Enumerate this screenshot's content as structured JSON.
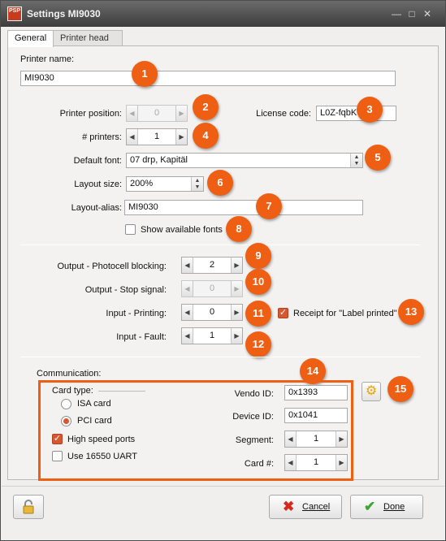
{
  "window": {
    "title": "Settings MI9030",
    "app_icon_text": "PSP"
  },
  "tabs": [
    {
      "label": "General",
      "active": true
    },
    {
      "label": "Printer head",
      "active": false
    }
  ],
  "general": {
    "printer_name_label": "Printer name:",
    "printer_name_value": "MI9030",
    "printer_position_label": "Printer position:",
    "printer_position_value": "0",
    "license_code_label": "License code:",
    "license_code_value": "L0Z-fqbK",
    "num_printers_label": "# printers:",
    "num_printers_value": "1",
    "default_font_label": "Default font:",
    "default_font_value": "07 drp, Kapitäl",
    "layout_size_label": "Layout size:",
    "layout_size_value": "200%",
    "layout_alias_label": "Layout-alias:",
    "layout_alias_value": "MI9030",
    "show_fonts_label": "Show available fonts",
    "show_fonts_checked": false
  },
  "io": {
    "photocell_label": "Output - Photocell blocking:",
    "photocell_value": "2",
    "stop_signal_label": "Output - Stop signal:",
    "stop_signal_value": "0",
    "printing_label": "Input - Printing:",
    "printing_value": "0",
    "fault_label": "Input - Fault:",
    "fault_value": "1",
    "receipt_label": "Receipt for \"Label printed\"",
    "receipt_checked": true
  },
  "communication": {
    "label": "Communication:",
    "card_type_label": "Card type:",
    "isa_label": "ISA card",
    "pci_label": "PCI card",
    "selected_card": "PCI card",
    "high_speed_label": "High speed ports",
    "high_speed_checked": true,
    "uart_label": "Use 16550 UART",
    "uart_checked": false,
    "vendo_id_label": "Vendo ID:",
    "vendo_id_value": "0x1393",
    "device_id_label": "Device ID:",
    "device_id_value": "0x1041",
    "segment_label": "Segment:",
    "segment_value": "1",
    "card_num_label": "Card #:",
    "card_num_value": "1"
  },
  "callouts": [
    "1",
    "2",
    "3",
    "4",
    "5",
    "6",
    "7",
    "8",
    "9",
    "10",
    "11",
    "12",
    "13",
    "14",
    "15"
  ],
  "footer": {
    "cancel_label": "Cancel",
    "done_label": "Done"
  },
  "colors": {
    "callout": "#ee5f14",
    "title_bar": "#4a4a4a",
    "checked": "#d9572f"
  },
  "icons": {
    "lock": "lock-icon",
    "cancel": "red-x-icon",
    "done": "green-check-icon",
    "settings": "gear-icon"
  }
}
